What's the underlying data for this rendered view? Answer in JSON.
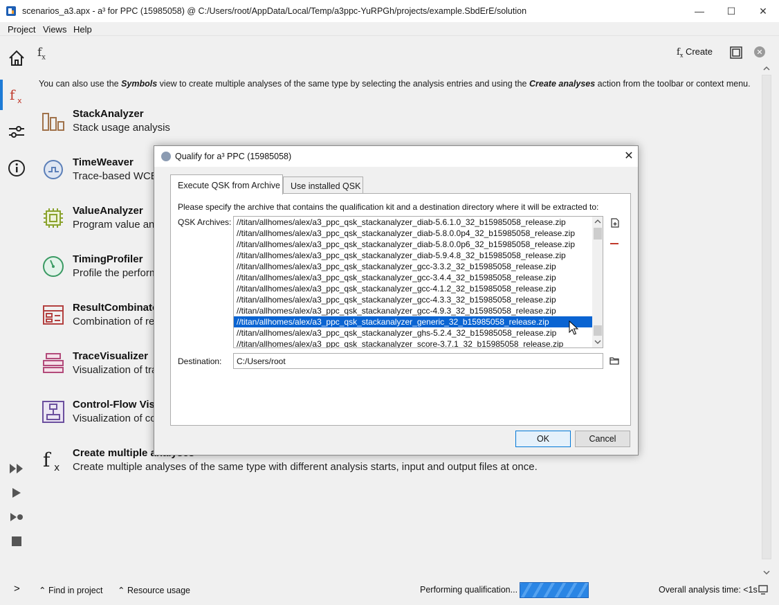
{
  "window": {
    "title": "scenarios_a3.apx - a³ for PPC (15985058) @ C:/Users/root/AppData/Local/Temp/a3ppc-YuRPGh/projects/example.SbdErE/solution",
    "minimize": "—",
    "maximize": "☐",
    "close": "✕"
  },
  "menu": {
    "project": "Project",
    "views": "Views",
    "help": "Help"
  },
  "view": {
    "fx_symbol": "f",
    "fx_sub": "x",
    "create_label": "Create",
    "close_glyph": "✕",
    "info_prefix": "You can also use the ",
    "info_symbols": "Symbols",
    "info_middle": " view to create multiple analyses of the same type by selecting the analysis entries and using the ",
    "info_create": "Create analyses",
    "info_suffix": " action from the toolbar or context menu."
  },
  "tools": [
    {
      "name": "StackAnalyzer",
      "desc": "Stack usage analysis",
      "icon": "stack-bars-icon"
    },
    {
      "name": "TimeWeaver",
      "desc": "Trace-based WCET analysis",
      "icon": "timeweaver-icon"
    },
    {
      "name": "ValueAnalyzer",
      "desc": "Program value analysis",
      "icon": "chip-icon"
    },
    {
      "name": "TimingProfiler",
      "desc": "Profile the performance",
      "icon": "gauge-icon"
    },
    {
      "name": "ResultCombinator",
      "desc": "Combination of results",
      "icon": "result-combinator-icon"
    },
    {
      "name": "TraceVisualizer",
      "desc": "Visualization of traces",
      "icon": "trace-visualizer-icon"
    },
    {
      "name": "Control-Flow Visualizer",
      "desc": "Visualization of control flow",
      "icon": "control-flow-icon"
    },
    {
      "name": "Create multiple analyses",
      "desc": "Create multiple analyses of the same type with different analysis starts, input and output files at once.",
      "icon": "fx-icon"
    }
  ],
  "status": {
    "expand": ">",
    "find_in_project": "Find in project",
    "resource_usage": "Resource usage",
    "qualification": "Performing qualification...",
    "analysis_time": "Overall analysis time: <1s"
  },
  "dialog": {
    "title": "Qualify for a³ PPC (15985058)",
    "close": "✕",
    "tab_archive": "Execute QSK from Archive",
    "tab_installed": "Use installed QSK",
    "instruction": "Please specify the archive that contains the qualification kit and a destination directory where it will be extracted to:",
    "qsk_label": "QSK Archives:",
    "archives": [
      "//titan/allhomes/alex/a3_ppc_qsk_stackanalyzer_diab-5.6.1.0_32_b15985058_release.zip",
      "//titan/allhomes/alex/a3_ppc_qsk_stackanalyzer_diab-5.8.0.0p4_32_b15985058_release.zip",
      "//titan/allhomes/alex/a3_ppc_qsk_stackanalyzer_diab-5.8.0.0p6_32_b15985058_release.zip",
      "//titan/allhomes/alex/a3_ppc_qsk_stackanalyzer_diab-5.9.4.8_32_b15985058_release.zip",
      "//titan/allhomes/alex/a3_ppc_qsk_stackanalyzer_gcc-3.3.2_32_b15985058_release.zip",
      "//titan/allhomes/alex/a3_ppc_qsk_stackanalyzer_gcc-3.4.4_32_b15985058_release.zip",
      "//titan/allhomes/alex/a3_ppc_qsk_stackanalyzer_gcc-4.1.2_32_b15985058_release.zip",
      "//titan/allhomes/alex/a3_ppc_qsk_stackanalyzer_gcc-4.3.3_32_b15985058_release.zip",
      "//titan/allhomes/alex/a3_ppc_qsk_stackanalyzer_gcc-4.9.3_32_b15985058_release.zip",
      "//titan/allhomes/alex/a3_ppc_qsk_stackanalyzer_generic_32_b15985058_release.zip",
      "//titan/allhomes/alex/a3_ppc_qsk_stackanalyzer_ghs-5.2.4_32_b15985058_release.zip",
      "//titan/allhomes/alex/a3_ppc_qsk_stackanalyzer_score-3.7.1_32_b15985058_release.zip"
    ],
    "selected_index": 9,
    "dest_label": "Destination:",
    "dest_value": "C:/Users/root",
    "ok": "OK",
    "cancel": "Cancel"
  },
  "colors": {
    "accent": "#1e7bd6",
    "selection": "#0a64d2",
    "tool_icon": "#7a5a9e"
  }
}
